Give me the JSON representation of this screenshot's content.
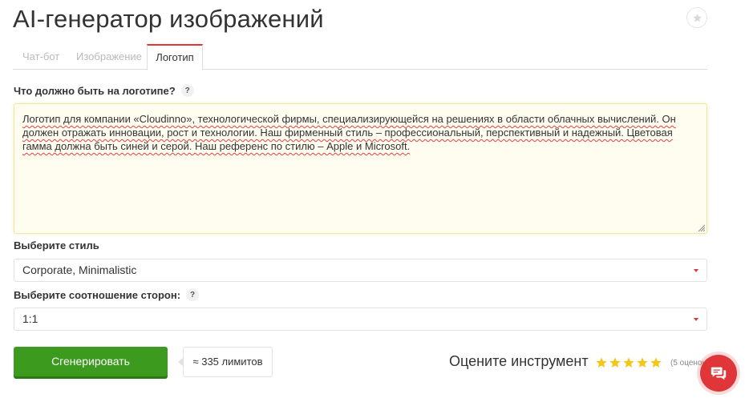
{
  "page": {
    "title": "AI-генератор изображений"
  },
  "tabs": [
    {
      "label": "Чат-бот",
      "active": false
    },
    {
      "label": "Изображение",
      "active": false
    },
    {
      "label": "Логотип",
      "active": true
    }
  ],
  "form": {
    "prompt_label": "Что должно быть на логотипе?",
    "prompt_value": "Логотип для компании «Cloudinno», технологической фирмы, специализирующейся на решениях в области облачных вычислений. Он должен отражать инновации, рост и технологии. Наш фирменный стиль – профессиональный, перспективный и надежный. Цветовая гамма должна быть синей и серой. Наш референс по стилю – Apple и Microsoft.",
    "style_label": "Выберите стиль",
    "style_value": "Corporate, Minimalistic",
    "ratio_label": "Выберите соотношение сторон:",
    "ratio_value": "1:1",
    "help_glyph": "?"
  },
  "actions": {
    "generate_label": "Сгенерировать",
    "limits_text": "≈ 335 лимитов"
  },
  "rating": {
    "label": "Оцените инструмент",
    "stars": 5,
    "count_text": "(5 оценок)"
  },
  "colors": {
    "accent_red": "#e0363a",
    "button_green": "#3c9a1f",
    "star_gold": "#f5c518"
  },
  "icons": {
    "favorite": "star-icon",
    "chat": "chat-icon",
    "help": "question-icon"
  }
}
